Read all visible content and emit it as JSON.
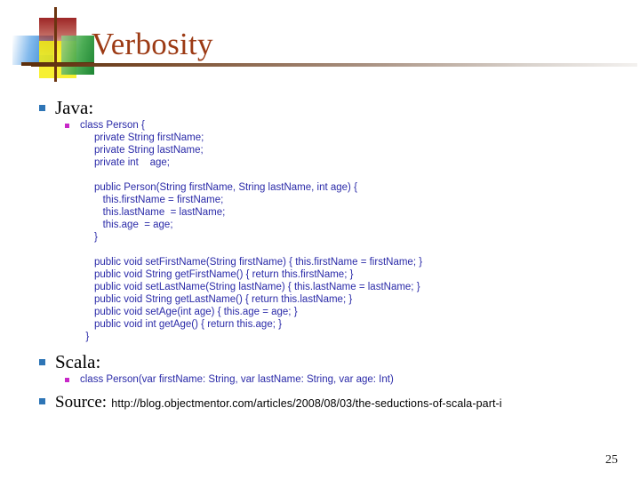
{
  "slide": {
    "title": "Verbosity",
    "number": "25",
    "colors": {
      "title": "#9c3a14",
      "rule": "#5d2f0c",
      "bullet_level1": "#2e75b6",
      "bullet_level2": "#c828c8",
      "code_text": "#2a2aa8",
      "background": "#ffffff"
    }
  },
  "content": {
    "java": {
      "heading": "Java:",
      "code": "class Person {\n     private String firstName;\n     private String lastName;\n     private int    age;\n\n     public Person(String firstName, String lastName, int age) {\n        this.firstName = firstName;\n        this.lastName  = lastName;\n        this.age  = age;\n     }\n\n     public void setFirstName(String firstName) { this.firstName = firstName; }\n     public void String getFirstName() { return this.firstName; }\n     public void setLastName(String lastName) { this.lastName = lastName; }\n     public void String getLastName() { return this.lastName; }\n     public void setAge(int age) { this.age = age; }\n     public void int getAge() { return this.age; }\n  }"
    },
    "scala": {
      "heading": "Scala:",
      "code": "class Person(var firstName: String, var lastName: String, var age: Int)"
    },
    "source": {
      "label": "Source:",
      "url": "http://blog.objectmentor.com/articles/2008/08/03/the-seductions-of-scala-part-i"
    }
  }
}
